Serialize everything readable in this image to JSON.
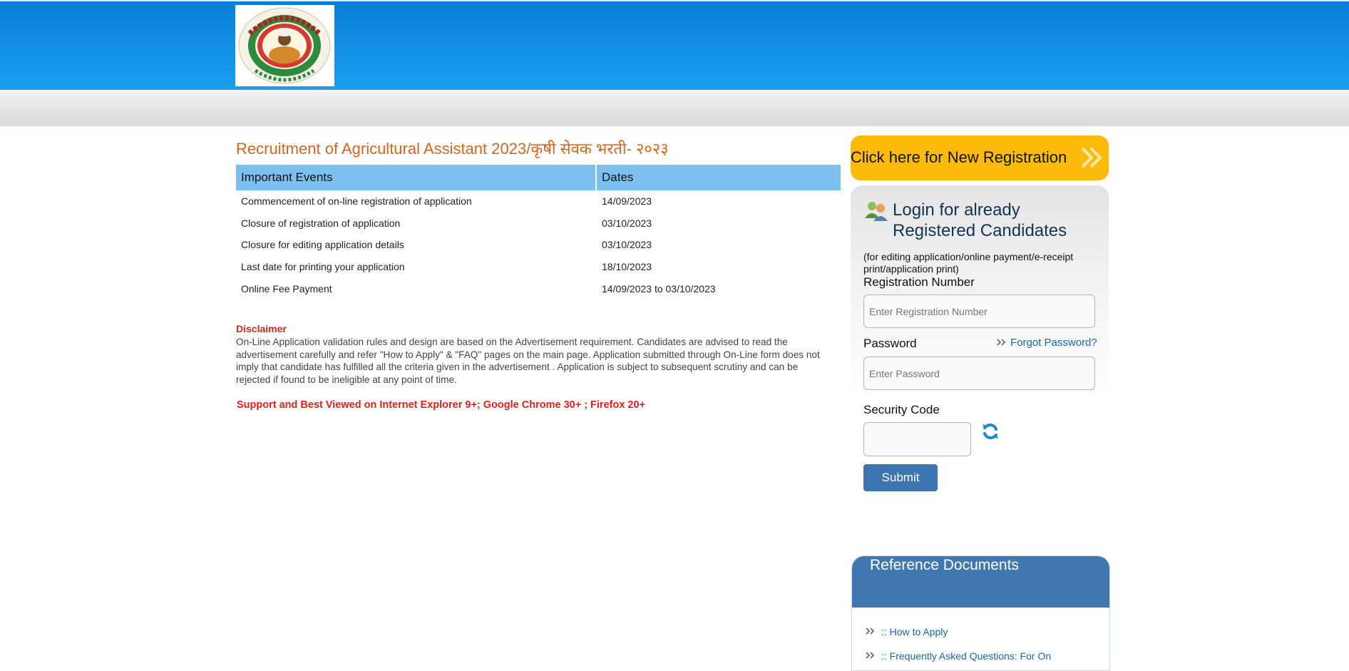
{
  "header": {
    "logo_name": "Krishi Vibhag, Maharashtra Shasan logo",
    "logo_text": "शेतक-यांच्या सेवेशी"
  },
  "main": {
    "title": "Recruitment of Agricultural Assistant 2023/कृषी सेवक भरती- २०२३",
    "events_table": {
      "columns": [
        "Important Events",
        "Dates"
      ],
      "rows": [
        {
          "event": "Commencement of on-line registration of application",
          "date": "14/09/2023"
        },
        {
          "event": "Closure of registration of application",
          "date": "03/10/2023"
        },
        {
          "event": "Closure for editing application details",
          "date": "03/10/2023"
        },
        {
          "event": "Last date for printing your application",
          "date": "18/10/2023"
        },
        {
          "event": "Online Fee Payment",
          "date": "14/09/2023 to 03/10/2023"
        }
      ]
    },
    "disclaimer_heading": "Disclaimer",
    "disclaimer_text": "On-Line Application validation rules and design are based on the Advertisement requirement. Candidates are advised to read the advertisement carefully and refer \"How to Apply\" & \"FAQ\" pages on the main page. Application submitted through On-Line form does not imply that candidate has fulfilled all the criteria given in the advertisement . Application is subject to subsequent scrutiny and can be rejected if found to be ineligible at any point of time.",
    "support_note": "Support and Best Viewed on Internet Explorer 9+; Google Chrome 30+ ; Firefox 20+"
  },
  "sidebar": {
    "new_registration_label": "Click here for New Registration",
    "login_heading": "Login for already Registered Candidates",
    "login_subtext": "(for editing application/online payment/e-receipt print/application print)",
    "registration_number_label": "Registration Number",
    "registration_number_placeholder": "Enter Registration Number",
    "password_label": "Password",
    "password_placeholder": "Enter Password",
    "forgot_password_label": "Forgot Password?",
    "security_code_label": "Security Code",
    "submit_label": "Submit",
    "reference_title": "Reference Documents",
    "reference_items": [
      ":: How to Apply",
      ":: Frequently Asked Questions: For On"
    ]
  },
  "colors": {
    "header_blue": "#0a7ed6",
    "title_orange": "#d9651a",
    "table_header": "#7bc0ef",
    "alert_red": "#e0201a",
    "registration_yellow": "#fcba0a",
    "button_blue": "#3d75b0",
    "link_blue": "#1f63a8"
  },
  "icons": [
    "logo",
    "double-chevron-right-icon",
    "users-icon",
    "refresh-icon"
  ]
}
